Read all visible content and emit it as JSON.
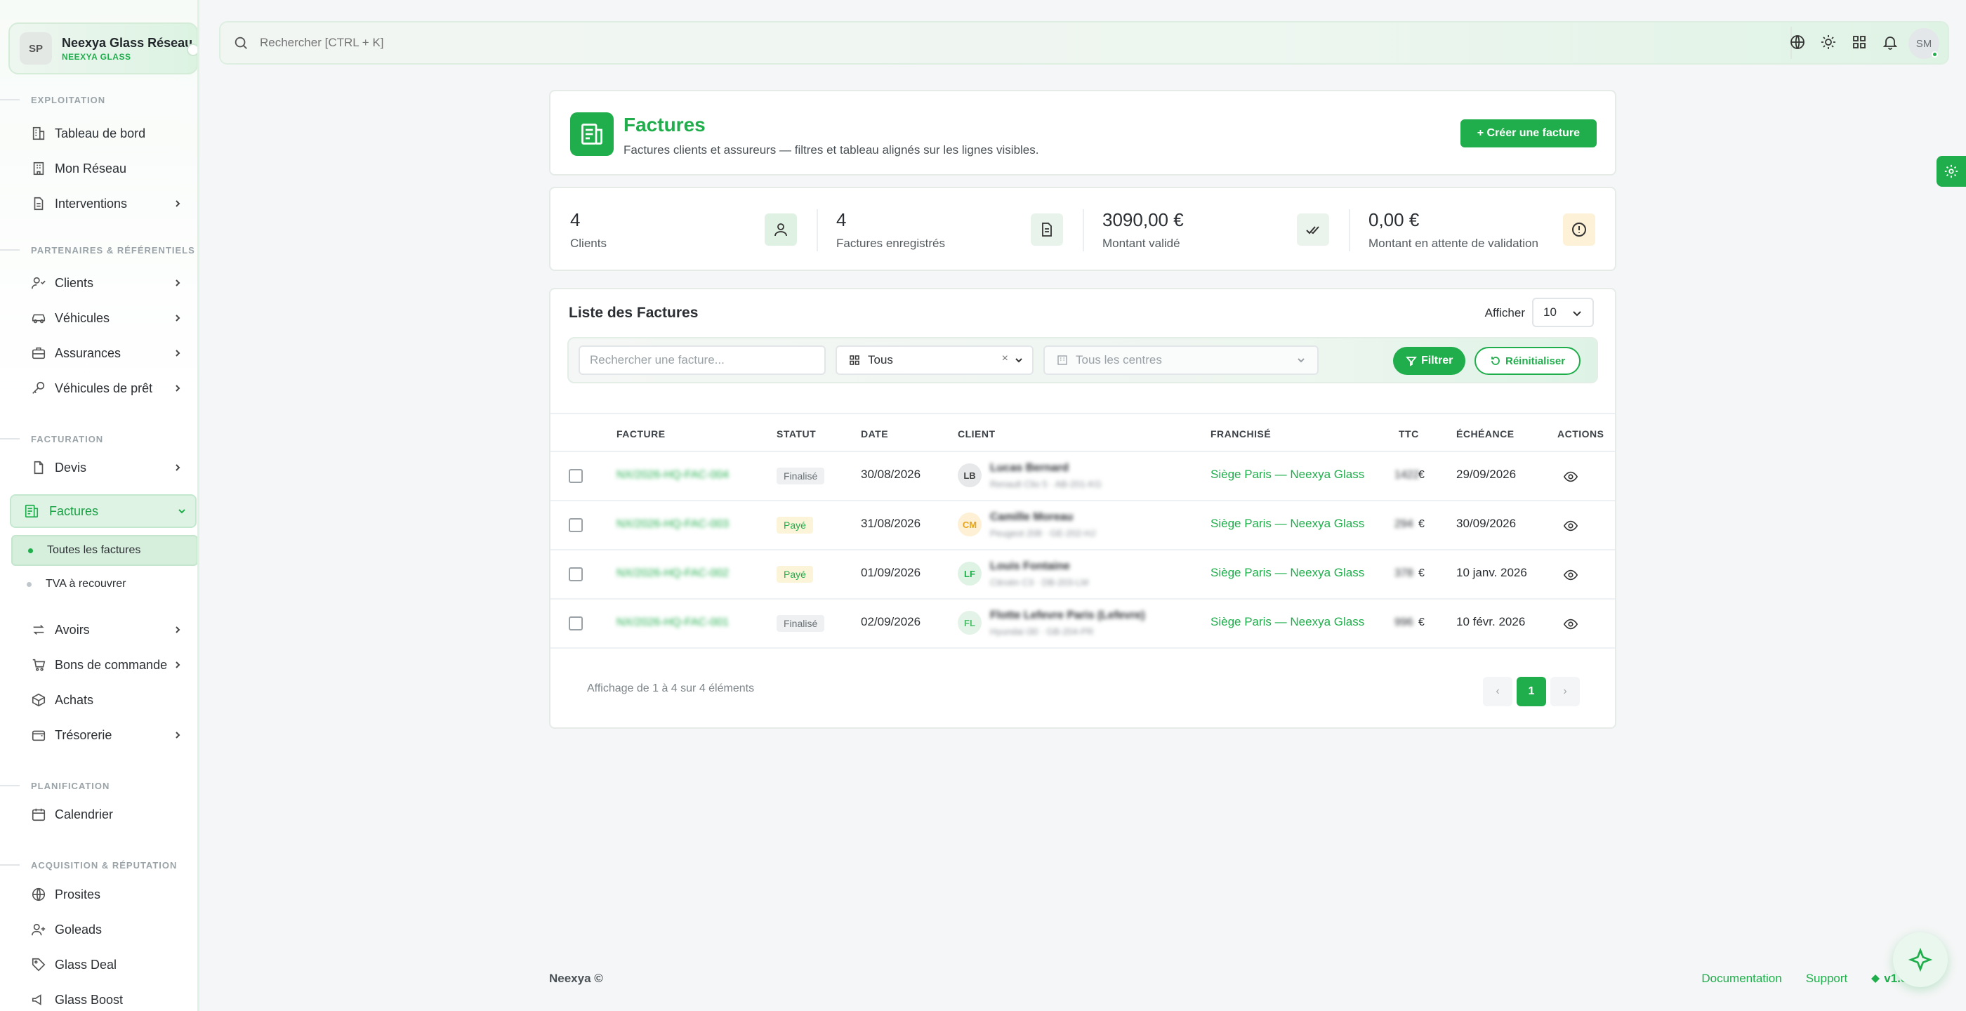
{
  "brand": {
    "initials": "SP",
    "name": "Neexya Glass Réseau",
    "sub": "NEEXYA GLASS"
  },
  "sidebar": {
    "sections": [
      "EXPLOITATION",
      "PARTENAIRES & RÉFÉRENTIELS",
      "FACTURATION",
      "PLANIFICATION",
      "ACQUISITION & RÉPUTATION"
    ],
    "items": [
      "Tableau de bord",
      "Mon Réseau",
      "Interventions",
      "Clients",
      "Véhicules",
      "Assurances",
      "Véhicules de prêt",
      "Devis",
      "Factures",
      "Avoirs",
      "Bons de commande",
      "Achats",
      "Trésorerie",
      "Calendrier",
      "Prosites",
      "Goleads",
      "Glass Deal",
      "Glass Boost"
    ],
    "sub_items": [
      "Toutes les factures",
      "TVA à recouvrer"
    ]
  },
  "topbar": {
    "search_placeholder": "Rechercher [CTRL + K]",
    "avatar": "SM"
  },
  "hero": {
    "title": "Factures",
    "description": "Factures clients et assureurs — filtres et tableau alignés sur les lignes visibles.",
    "create_label": "+ Créer une facture"
  },
  "stats": [
    {
      "value": "4",
      "label": "Clients"
    },
    {
      "value": "4",
      "label": "Factures enregistrés"
    },
    {
      "value": "3090,00 €",
      "label": "Montant validé"
    },
    {
      "value": "0,00 €",
      "label": "Montant en attente de validation"
    }
  ],
  "list": {
    "title": "Liste des Factures",
    "show_label": "Afficher",
    "page_size": "10",
    "search_placeholder": "Rechercher une facture...",
    "status_value": "Tous",
    "status_clear": "×",
    "centre_placeholder": "Tous les centres",
    "filter_label": "Filtrer",
    "reset_label": "Réinitialiser",
    "columns": [
      "FACTURE",
      "STATUT",
      "DATE",
      "CLIENT",
      "FRANCHISÉ",
      "TTC",
      "ÉCHÉANCE",
      "ACTIONS"
    ],
    "rows": [
      {
        "number": "NX/2026-HQ-FAC-004",
        "status": "Finalisé",
        "date": "30/08/2026",
        "initials": "LB",
        "client": "Lucas Bernard",
        "client_sub": "Renault Clio 5 · AB-201-KG",
        "franchise": "Siège Paris — Neexya Glass",
        "ttc": "1422",
        "currency": "€",
        "due": "29/09/2026"
      },
      {
        "number": "NX/2026-HQ-FAC-003",
        "status": "Payé",
        "date": "31/08/2026",
        "initials": "CM",
        "client": "Camille Moreau",
        "client_sub": "Peugeot 208 · GE-202-HJ",
        "franchise": "Siège Paris — Neexya Glass",
        "ttc": "294",
        "currency": "€",
        "due": "30/09/2026"
      },
      {
        "number": "NX/2026-HQ-FAC-002",
        "status": "Payé",
        "date": "01/09/2026",
        "initials": "LF",
        "client": "Louis Fontaine",
        "client_sub": "Citroën C3 · DB-203-LM",
        "franchise": "Siège Paris — Neexya Glass",
        "ttc": "378",
        "currency": "€",
        "due": "10 janv. 2026"
      },
      {
        "number": "NX/2026-HQ-FAC-001",
        "status": "Finalisé",
        "date": "02/09/2026",
        "initials": "FL",
        "client": "Flotte Lefevre Paris (Lefevre)",
        "client_sub": "Hyundai i30 · GB-204-PR",
        "franchise": "Siège Paris — Neexya Glass",
        "ttc": "996",
        "currency": "€",
        "due": "10 févr. 2026"
      }
    ],
    "footer_info": "Affichage de 1 à 4 sur 4 éléments",
    "page_prev": "‹",
    "page_current": "1",
    "page_next": "›"
  },
  "footer": {
    "copyright": "Neexya ©",
    "documentation": "Documentation",
    "support": "Support",
    "version": "v1.0.31"
  },
  "colors": {
    "accent": "#1fae4b",
    "accent_light": "#dff3e5"
  }
}
